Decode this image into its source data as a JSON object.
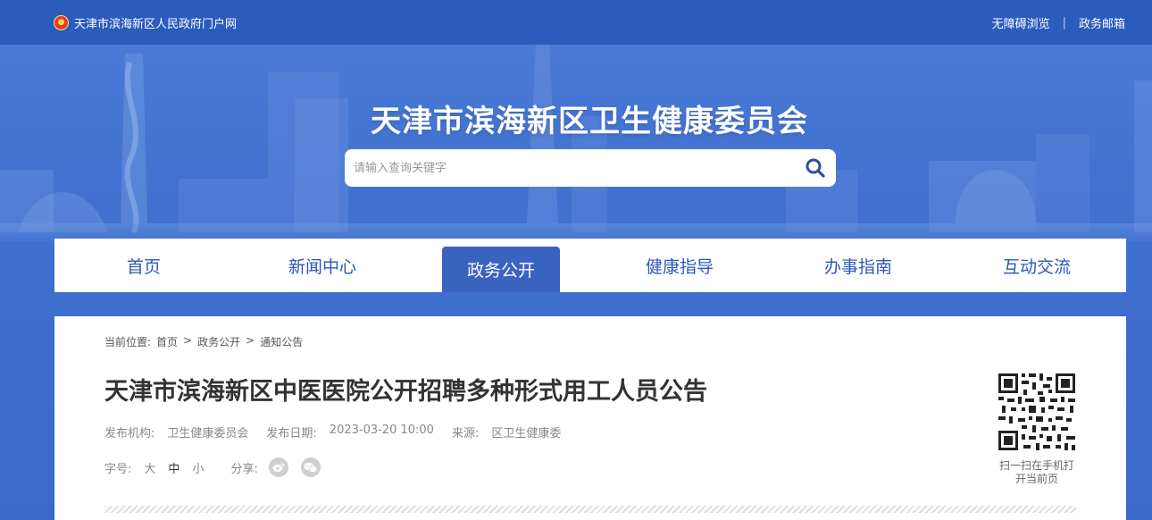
{
  "topbar": {
    "portal_name": "天津市滨海新区人民政府门户网",
    "accessibility_link": "无障碍浏览",
    "separator": "|",
    "mail_link": "政务邮箱"
  },
  "header": {
    "site_title": "天津市滨海新区卫生健康委员会"
  },
  "search": {
    "placeholder": "请输入查询关键字",
    "icon": "search-icon"
  },
  "nav": {
    "items": [
      {
        "label": "首页"
      },
      {
        "label": "新闻中心"
      },
      {
        "label": "政务公开",
        "active": true
      },
      {
        "label": "健康指导"
      },
      {
        "label": "办事指南"
      },
      {
        "label": "互动交流"
      }
    ]
  },
  "breadcrumb": {
    "prefix": "当前位置:",
    "items": [
      "首页",
      "政务公开",
      "通知公告"
    ],
    "separator": ">"
  },
  "article": {
    "title": "天津市滨海新区中医医院公开招聘多种形式用工人员公告",
    "publisher_label": "发布机构:",
    "publisher": "卫生健康委员会",
    "date_label": "发布日期:",
    "date": "2023-03-20 10:00",
    "source_label": "来源:",
    "source": "区卫生健康委",
    "font_size_label": "字号:",
    "font_sizes": [
      "大",
      "中",
      "小"
    ],
    "share_label": "分享:",
    "share_icons": [
      "weibo-icon",
      "wechat-icon"
    ]
  },
  "qr": {
    "caption_line1": "扫一扫在手机打",
    "caption_line2": "开当前页"
  },
  "colors": {
    "brand_blue": "#2b57b6",
    "nav_active": "#3a63c0",
    "topbar": "#2b5bbd"
  }
}
